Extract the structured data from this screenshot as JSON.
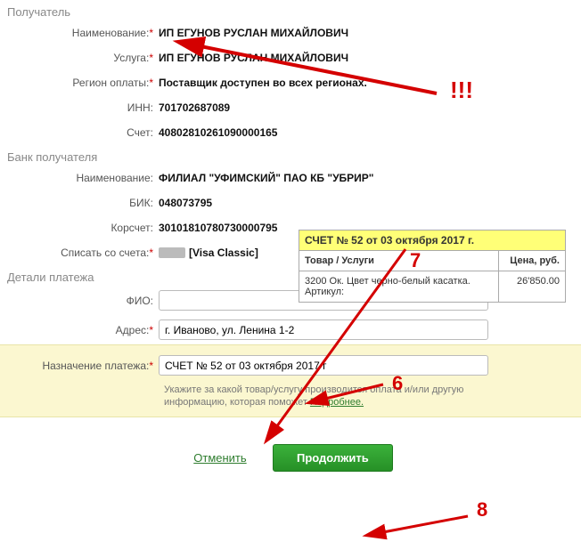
{
  "sections": {
    "recipient": "Получатель",
    "bank": "Банк получателя",
    "details": "Детали платежа"
  },
  "labels": {
    "name": "Наименование:",
    "service": "Услуга:",
    "region": "Регион оплаты:",
    "inn": "ИНН:",
    "account": "Счет:",
    "bik": "БИК:",
    "corr": "Корсчет:",
    "debit": "Списать со счета:",
    "fio": "ФИО:",
    "address": "Адрес:",
    "purpose": "Назначение платежа:"
  },
  "values": {
    "name": "ИП ЕГУНОВ РУСЛАН МИХАЙЛОВИЧ",
    "service": "ИП ЕГУНОВ РУСЛАН МИХАЙЛОВИЧ",
    "region": "Поставщик доступен во всех регионах.",
    "inn": "701702687089",
    "account": "40802810261090000165",
    "bank_name": "ФИЛИАЛ \"УФИМСКИЙ\" ПАО КБ \"УБРИР\"",
    "bik": "048073795",
    "corr": "30101810780730000795",
    "debit_card": "[Visa Classic]",
    "fio": "",
    "address": "г. Иваново, ул. Ленина 1-2",
    "purpose": "СЧЕТ № 52 от 03 октября 2017 г"
  },
  "invoice": {
    "title": "СЧЕТ № 52 от 03 октября 2017 г.",
    "header_goods": "Товар / Услуги",
    "header_price": "Цена, руб.",
    "item": "3200 Ок. Цвет черно-белый касатка. Артикул:",
    "price": "26'850.00"
  },
  "hint": {
    "text": "Укажите за какой товар/услугу производится оплата и/или другую информацию, которая поможет ",
    "link": "Подробнее."
  },
  "buttons": {
    "cancel": "Отменить",
    "continue": "Продолжить"
  },
  "anno": {
    "exclaim": "!!!",
    "n6": "6",
    "n7": "7",
    "n8": "8"
  }
}
